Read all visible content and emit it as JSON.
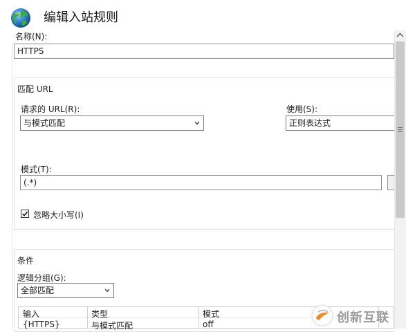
{
  "header": {
    "title": "编辑入站规则",
    "icon": "globe-icon"
  },
  "name": {
    "label": "名称(N):",
    "value": "HTTPS"
  },
  "match_url": {
    "group_label": "匹配 URL",
    "requested_url_label": "请求的 URL(R):",
    "requested_url_value": "与模式匹配",
    "using_label": "使用(S):",
    "using_value": "正则表达式",
    "pattern_label": "模式(T):",
    "pattern_value": "(.*)",
    "ignore_case_label": "忽略大小写(I)",
    "ignore_case_checked": true
  },
  "conditions": {
    "group_label": "条件",
    "logical_grouping_label": "逻辑分组(G):",
    "logical_grouping_value": "全部匹配",
    "columns": [
      "输入",
      "类型",
      "模式"
    ],
    "rows": [
      {
        "input": "{HTTPS}",
        "type": "与模式匹配",
        "pattern": "off"
      }
    ]
  },
  "watermark": {
    "text": "创新互联"
  },
  "colors": {
    "scrollbar_thumb": "#c9c9c9",
    "border": "#e0e0e0",
    "watermark": "#9a9a9a"
  }
}
